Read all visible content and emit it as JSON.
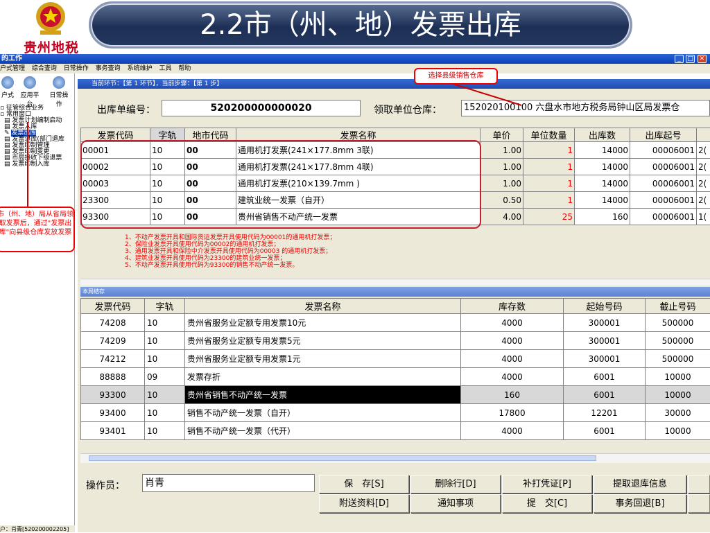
{
  "banner": {
    "title": "2.2市（州、地）发票出库",
    "logo_text": "贵州地税"
  },
  "window": {
    "title": "的工作",
    "buttons": [
      "_",
      "□",
      "✕"
    ]
  },
  "menu": [
    "户式管理",
    "综合查询",
    "日常操作",
    "事务查询",
    "系统维护",
    "工具",
    "帮助"
  ],
  "toolbar": [
    {
      "label": "户式",
      "icon": "home-icon"
    },
    {
      "label": "应用平台",
      "icon": "search-icon"
    },
    {
      "label": "日常操作",
      "icon": "gear-icon"
    }
  ],
  "tree": [
    {
      "label": "征管综合业务",
      "selected": false
    },
    {
      "label": "常用窗口",
      "selected": false
    },
    {
      "label": "发票计划编制启动",
      "selected": false
    },
    {
      "label": "发票入库",
      "selected": false
    },
    {
      "label": "发票出库",
      "selected": true
    },
    {
      "label": "发票退库(部门退库",
      "selected": false
    },
    {
      "label": "发票印制管理",
      "selected": false
    },
    {
      "label": "发票印制变更",
      "selected": false
    },
    {
      "label": "市局接收下级退票",
      "selected": false
    },
    {
      "label": "发票印制入库",
      "selected": false
    }
  ],
  "statusbar": "户：肖青[520200002205]",
  "step_bar": "当前环节：【第 1 环节】，当前步骤：【第 1 步】",
  "form": {
    "order_label": "出库单编号：",
    "order_value": "520200000000020",
    "warehouse_label": "领取单位仓库：",
    "warehouse_value": "152020100100 六盘水市地方税务局钟山区局发票仓"
  },
  "grid1": {
    "headers": [
      "发票代码",
      "字轨",
      "地市代码",
      "发票名称",
      "单价",
      "单位数量",
      "出库数",
      "出库起号",
      ""
    ],
    "rows": [
      [
        "00001",
        "10",
        "00",
        "通用机打发票(241×177.8mm 3联)",
        "1.00",
        "1",
        "14000",
        "00006001",
        "2("
      ],
      [
        "00002",
        "10",
        "00",
        "通用机打发票(241×177.8mm 4联)",
        "1.00",
        "1",
        "14000",
        "00006001",
        "2("
      ],
      [
        "00003",
        "10",
        "00",
        "通用机打发票(210×139.7mm )",
        "1.00",
        "1",
        "14000",
        "00006001",
        "2("
      ],
      [
        "23300",
        "10",
        "00",
        "建筑业统一发票（自开）",
        "0.50",
        "1",
        "14000",
        "00006001",
        "2("
      ],
      [
        "93300",
        "10",
        "00",
        "贵州省销售不动产统一发票",
        "4.00",
        "25",
        "160",
        "00006001",
        "1("
      ]
    ]
  },
  "notes": [
    "1、不动产发票开具和国际货运发票开具使用代码为00001的通用机打发票；",
    "2、保险业发票开具使用代码为00002的通用机打发票；",
    "3、通用发票开具和保险中介发票开具使用代码为00003 的通用机打发票；",
    "4、建筑业发票开具使用代码为23300的建筑业统一发票；",
    "5、不动产发票开具使用代码为93300的销售不动产统一发票。"
  ],
  "section2_title": "本局结存",
  "grid2": {
    "headers": [
      "发票代码",
      "字轨",
      "发票名称",
      "库存数",
      "起始号码",
      "截止号码"
    ],
    "rows": [
      [
        "74208",
        "10",
        "贵州省服务业定额专用发票10元",
        "4000",
        "300001",
        "500000"
      ],
      [
        "74209",
        "10",
        "贵州省服务业定额专用发票5元",
        "4000",
        "300001",
        "500000"
      ],
      [
        "74212",
        "10",
        "贵州省服务业定额专用发票1元",
        "4000",
        "300001",
        "500000"
      ],
      [
        "88888",
        "09",
        "发票存折",
        "4000",
        "6001",
        "10000"
      ],
      [
        "93300",
        "10",
        "贵州省销售不动产统一发票",
        "160",
        "6001",
        "10000"
      ],
      [
        "93400",
        "10",
        "销售不动产统一发票（自开）",
        "17800",
        "12201",
        "30000"
      ],
      [
        "93401",
        "10",
        "销售不动产统一发票（代开）",
        "4000",
        "6001",
        "10000"
      ]
    ],
    "highlighted_row": 4
  },
  "operator": {
    "label": "操作员：",
    "value": "肖青"
  },
  "buttons_row1": [
    "保　存[S]",
    "删除行[D]",
    "补打凭证[P]",
    "提取退库信息",
    ""
  ],
  "buttons_row2": [
    "附送资料[D]",
    "通知事项",
    "提　交[C]",
    "事务回退[B]",
    ""
  ],
  "annotations": {
    "top": "选择县级销售仓库",
    "left": "市（州、地）局从省局领取发票后，通过\"发票出库\"向县级仓库发放发票"
  },
  "colors": {
    "title_bg": "#1d2f55",
    "annotation_red": "#e00000",
    "window_blue": "#0a3fb8"
  }
}
